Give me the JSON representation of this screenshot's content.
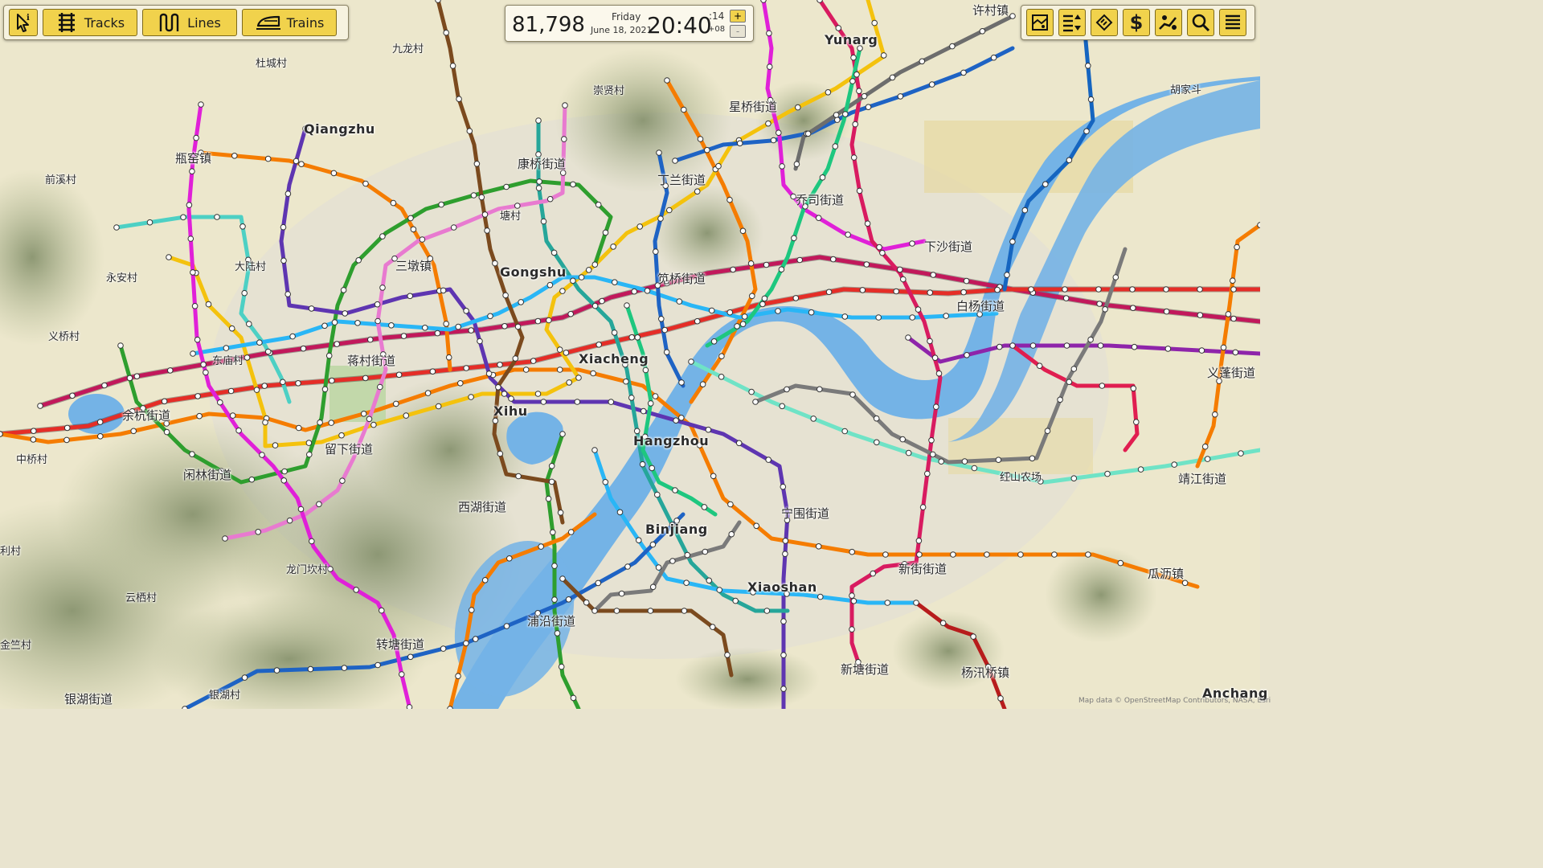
{
  "toolbar": {
    "select_icon": "select-info-icon",
    "tracks_label": "Tracks",
    "lines_label": "Lines",
    "trains_label": "Trains"
  },
  "clock": {
    "money": "81,798",
    "weekday": "Friday",
    "date": "June 18, 2021",
    "time": "20:40",
    "seconds": ":14",
    "timezone": "+08",
    "speed_up": "+",
    "speed_down": "-"
  },
  "right_toolbar": {
    "icons": [
      "map-layers-icon",
      "sort-list-icon",
      "ticket-icon",
      "dollar-icon",
      "demand-icon",
      "search-icon",
      "menu-icon"
    ]
  },
  "map_labels": {
    "yunarg": "Yunarg",
    "qiangzhu": "Qiangzhu",
    "gongshu": "Gongshu",
    "xiacheng": "Xiacheng",
    "xihu": "Xihu",
    "hangzhou": "Hangzhou",
    "binjiang": "Binjiang",
    "xiaoshan": "Xiaoshan",
    "anchang": "Anchang",
    "l_jiulongcun": "九龙村",
    "l_duchengcun": "杜城村",
    "l_chongxiancun": "崇贤村",
    "l_xuxiangjiedao": "许村镇",
    "l_hujiadou": "胡家斗",
    "l_pingyaozhen": "瓶窑镇",
    "l_qianxicun": "前溪村",
    "l_kangqiao": "康桥街道",
    "l_xingqiao": "星桥街道",
    "l_dinglan": "丁兰街道",
    "l_qiaosi": "乔司街道",
    "l_dalucun": "大陆村",
    "l_sandunzhen": "三墩镇",
    "l_yonganc": "永安村",
    "l_xiashajiedao": "下沙街道",
    "l_jianqiao": "笕桥街道",
    "l_baiyang": "白杨街道",
    "l_yiqiaocun": "义桥村",
    "l_donghucun": "东庙村",
    "l_jiangcun": "蒋村街道",
    "l_yipeng": "义蓬街道",
    "l_yuhang": "余杭街道",
    "l_zhongqiaocun": "中桥村",
    "l_liuxia": "留下街道",
    "l_xianlin": "闲林街道",
    "l_honghua": "红山农场",
    "l_jingjiang": "靖江街道",
    "l_xihujiedao": "西湖街道",
    "l_ningwei": "宁围街道",
    "l_licun": "利村",
    "l_longmenkan": "龙门坎村",
    "l_xinjie": "新街街道",
    "l_guali": "瓜沥镇",
    "l_yunqicun": "云栖村",
    "l_puyan": "浦沿街道",
    "l_jinzhucun": "金竺村",
    "l_zhuantang": "转塘街道",
    "l_xintang": "新塘街道",
    "l_yanghuqiao": "杨汛桥镇",
    "l_yinhu": "银湖街道",
    "l_yinhucun": "银湖村",
    "l_gangcun": "塘村"
  },
  "attribution": "Map data © OpenStreetMap Contributors, NASA, Esri",
  "colors": {
    "water": "#74b3e6",
    "land": "#ece7cc",
    "panel": "#fbf8ec",
    "button": "#f1d24c"
  }
}
